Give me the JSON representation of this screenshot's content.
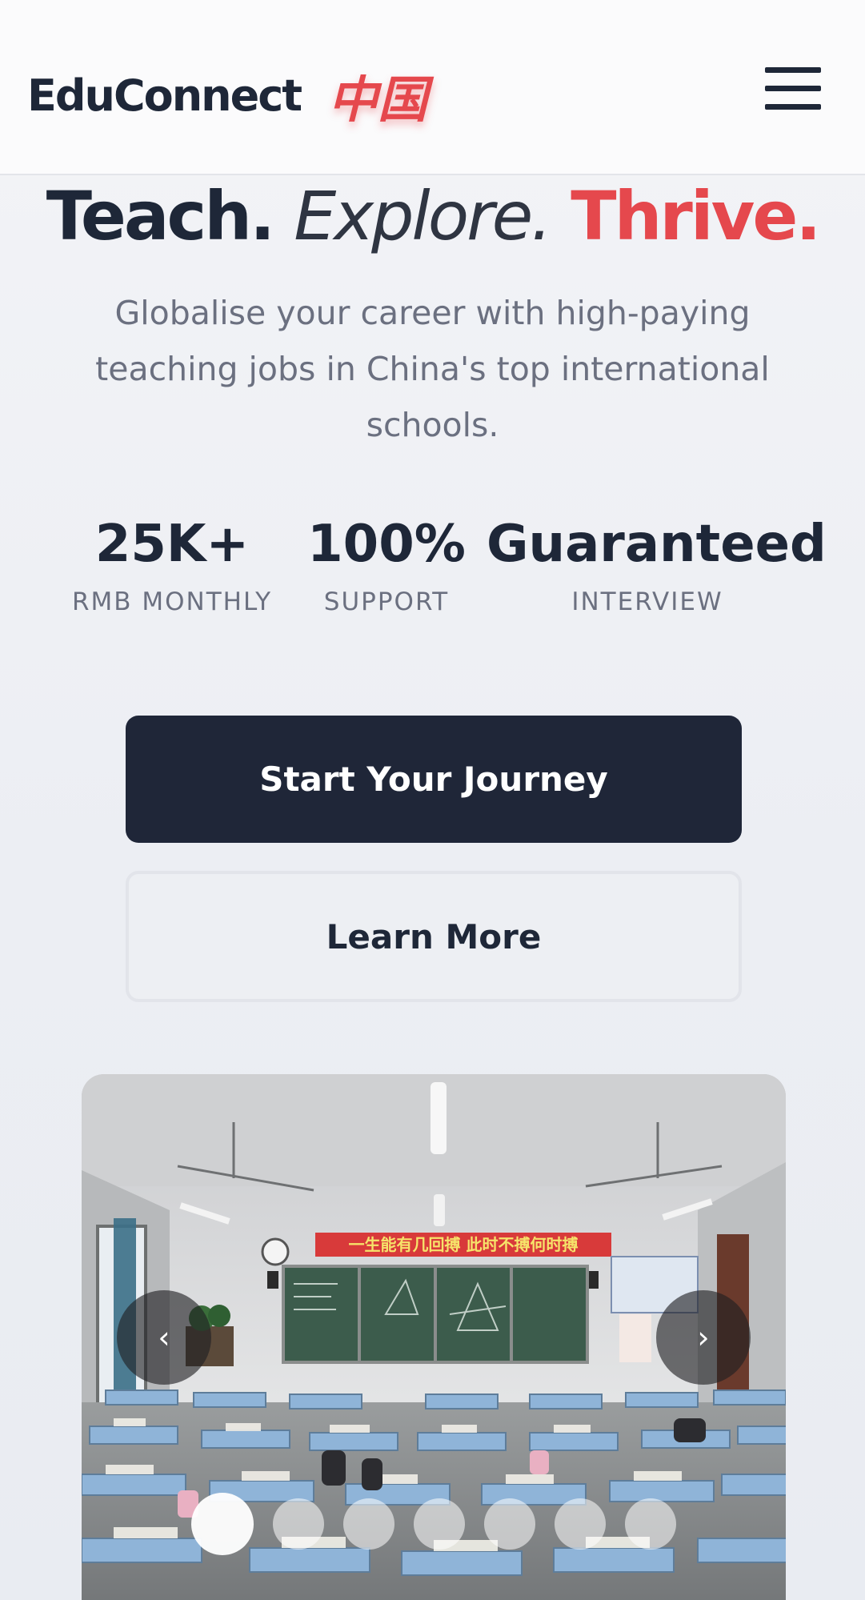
{
  "header": {
    "brand_name": "EduConnect",
    "brand_cn": "中国",
    "menu_icon": "hamburger-menu-icon"
  },
  "hero": {
    "headline_word1": "Teach.",
    "headline_word2": "Explore.",
    "headline_word3": "Thrive.",
    "subtitle": "Globalise your career with high-paying teaching jobs in China's top international schools."
  },
  "stats": [
    {
      "value": "25K+",
      "label": "RMB MONTHLY"
    },
    {
      "value": "100%",
      "label": "SUPPORT"
    },
    {
      "value": "Guaranteed",
      "label": "INTERVIEW"
    }
  ],
  "actions": {
    "primary_label": "Start Your Journey",
    "secondary_label": "Learn More"
  },
  "carousel": {
    "prev_label": "‹",
    "next_label": "›",
    "banner_text": "一生能有几回搏 此时不搏何时搏",
    "slide_count": 7,
    "active_slide": 1
  },
  "colors": {
    "accent_red": "#e5484d",
    "navy": "#1f2638",
    "text_muted": "#6b7080"
  }
}
